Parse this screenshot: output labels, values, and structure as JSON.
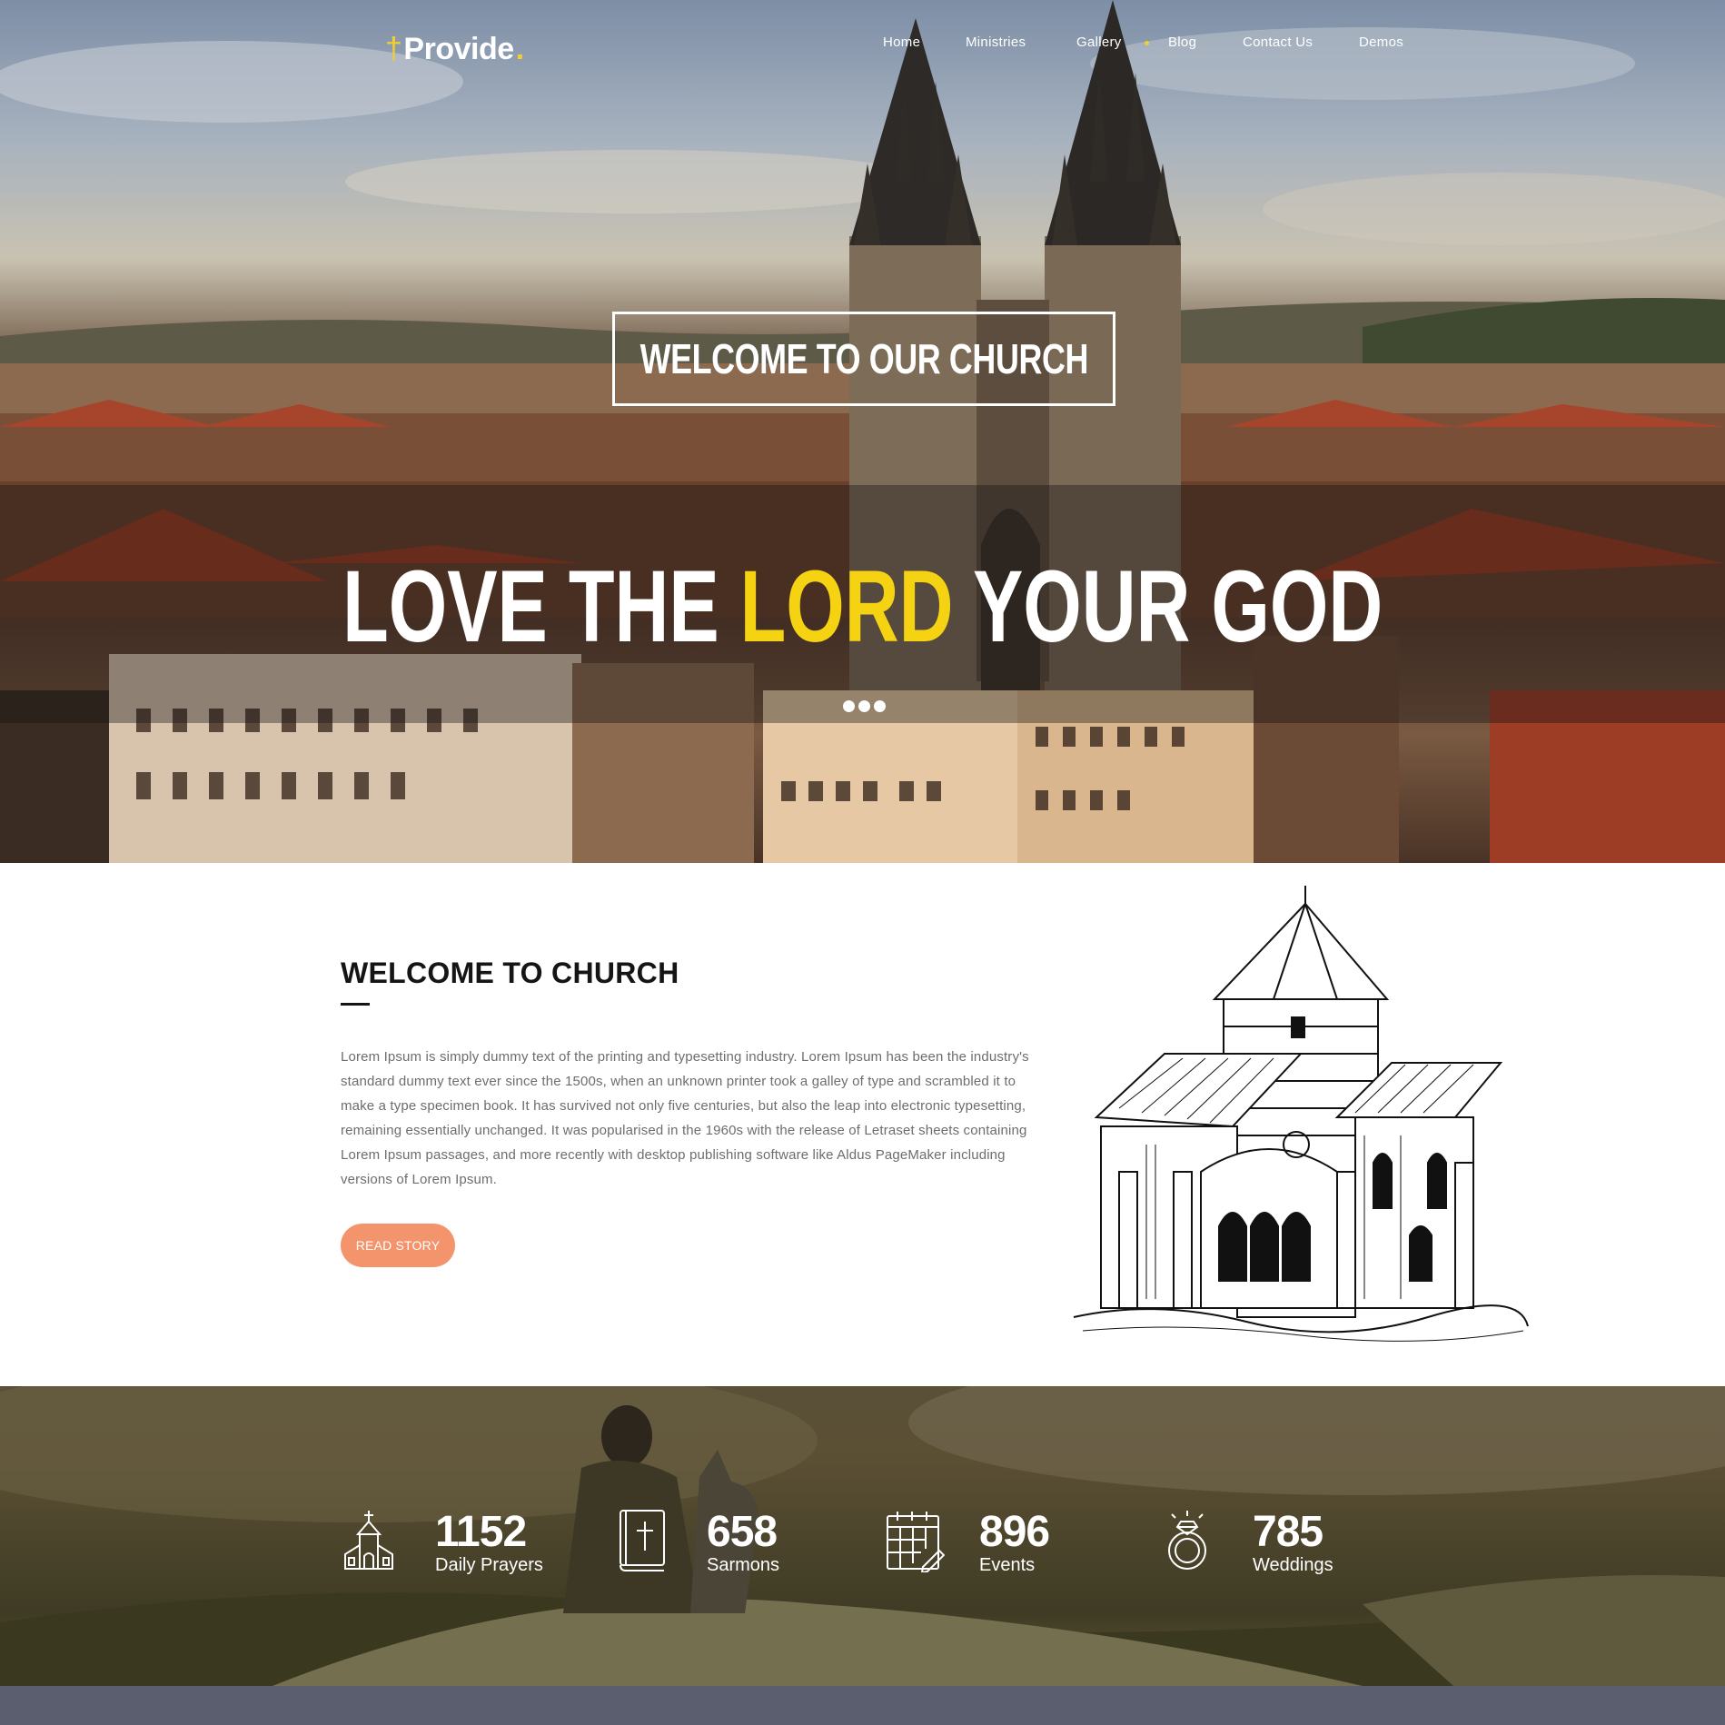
{
  "brand": {
    "name": "Provide",
    "dot": ".",
    "cross_glyph": "†",
    "accent_color": "#f2cf2e"
  },
  "nav": {
    "items": [
      "Home",
      "Ministries",
      "Gallery",
      "Blog",
      "Contact Us",
      "Demos"
    ]
  },
  "hero": {
    "welcome": "WELCOME TO OUR CHURCH",
    "headline_before": "LOVE THE ",
    "headline_accent": "LORD",
    "headline_after": " YOUR GOD",
    "headline_accent_color": "#f6d312",
    "slider_dots": 3
  },
  "about": {
    "title": "WELCOME TO CHURCH",
    "body": "Lorem Ipsum is simply dummy text of the printing and typesetting industry. Lorem Ipsum has been the industry's standard dummy text ever since the 1500s, when an unknown printer took a galley of type and scrambled it to make a type specimen book. It has survived not only five centuries, but also the leap into electronic typesetting, remaining essentially unchanged. It was popularised in the 1960s with the release of Letraset sheets containing Lorem Ipsum passages, and more recently with desktop publishing software like Aldus PageMaker including versions of Lorem Ipsum.",
    "button": "READ STORY",
    "button_color": "#f3946d"
  },
  "stats": [
    {
      "icon": "church-icon",
      "number": "1152",
      "label": "Daily Prayers"
    },
    {
      "icon": "bible-icon",
      "number": "658",
      "label": "Sarmons"
    },
    {
      "icon": "calendar-icon",
      "number": "896",
      "label": "Events"
    },
    {
      "icon": "ring-icon",
      "number": "785",
      "label": "Weddings"
    }
  ]
}
